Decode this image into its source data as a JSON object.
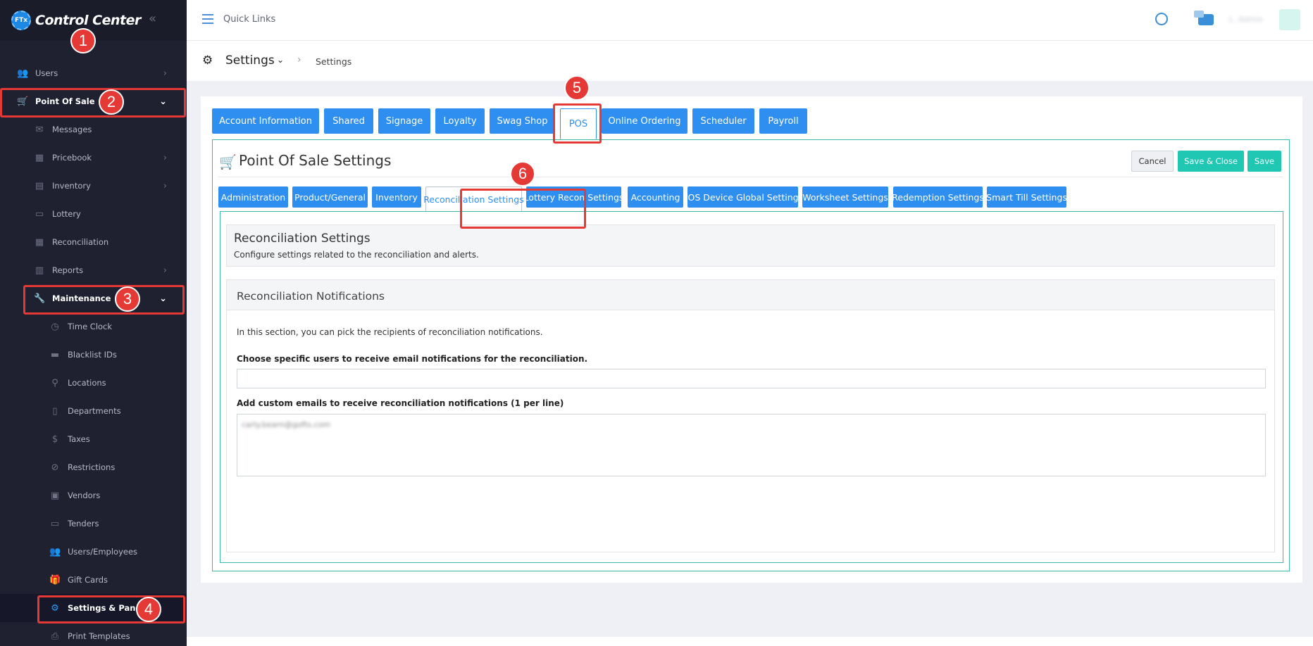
{
  "app": {
    "title": "Control Center",
    "logo_text": "FTx",
    "collapse_icon": "double-chevron-left-icon"
  },
  "topbar": {
    "quick_links": "Quick Links",
    "user_name": "L. Admin"
  },
  "breadcrumb": {
    "title": "Settings",
    "current": "Settings"
  },
  "sidebar": {
    "items": [
      {
        "label": "Users",
        "icon": "users-icon",
        "glyph": "👥",
        "chevron": "›"
      },
      {
        "label": "Point Of Sale",
        "icon": "cart-icon",
        "glyph": "🛒",
        "chevron": "⌄"
      },
      {
        "label": "Messages",
        "icon": "message-icon",
        "glyph": "✉"
      },
      {
        "label": "Pricebook",
        "icon": "calculator-icon",
        "glyph": "▦",
        "chevron": "›"
      },
      {
        "label": "Inventory",
        "icon": "inventory-icon",
        "glyph": "▤",
        "chevron": "›"
      },
      {
        "label": "Lottery",
        "icon": "ticket-icon",
        "glyph": "▭"
      },
      {
        "label": "Reconciliation",
        "icon": "grid-icon",
        "glyph": "▦"
      },
      {
        "label": "Reports",
        "icon": "chart-icon",
        "glyph": "▥",
        "chevron": "›"
      },
      {
        "label": "Maintenance",
        "icon": "wrench-icon",
        "glyph": "🔧",
        "chevron": "⌄"
      },
      {
        "label": "Time Clock",
        "icon": "clock-icon",
        "glyph": "◷"
      },
      {
        "label": "Blacklist IDs",
        "icon": "id-card-icon",
        "glyph": "▬"
      },
      {
        "label": "Locations",
        "icon": "map-pin-icon",
        "glyph": "⚲"
      },
      {
        "label": "Departments",
        "icon": "building-icon",
        "glyph": "▯"
      },
      {
        "label": "Taxes",
        "icon": "dollar-icon",
        "glyph": "$"
      },
      {
        "label": "Restrictions",
        "icon": "ban-icon",
        "glyph": "⊘"
      },
      {
        "label": "Vendors",
        "icon": "vendor-icon",
        "glyph": "▣"
      },
      {
        "label": "Tenders",
        "icon": "money-icon",
        "glyph": "▭"
      },
      {
        "label": "Users/Employees",
        "icon": "users-icon",
        "glyph": "👥"
      },
      {
        "label": "Gift Cards",
        "icon": "gift-icon",
        "glyph": "🎁"
      },
      {
        "label": "Settings & Panels",
        "icon": "gear-icon",
        "glyph": "⚙"
      },
      {
        "label": "Print Templates",
        "icon": "printer-icon",
        "glyph": "⎙"
      }
    ]
  },
  "main_tabs": [
    "Account Information",
    "Shared",
    "Signage",
    "Loyalty",
    "Swag Shop",
    "POS",
    "Online Ordering",
    "Scheduler",
    "Payroll"
  ],
  "section": {
    "title": "Point Of Sale Settings",
    "cancel": "Cancel",
    "save_close": "Save & Close",
    "save": "Save"
  },
  "sub_tabs": [
    "Administration",
    "Product/General",
    "Inventory",
    "Reconciliation Settings",
    "Lottery Recon Settings",
    "Accounting",
    "POS Device Global Settings",
    "Worksheet Settings",
    "Redemption Settings",
    "Smart Till Settings"
  ],
  "reconciliation": {
    "title": "Reconciliation Settings",
    "subtitle": "Configure settings related to the reconciliation and alerts.",
    "notifications_title": "Reconciliation Notifications",
    "description": "In this section, you can pick the recipients of reconciliation notifications.",
    "users_label": "Choose specific users to receive email notifications for the reconciliation.",
    "users_value": "",
    "emails_label": "Add custom emails to receive reconciliation notifications (1 per line)",
    "emails_value": "carly.bearn@gofts.com"
  },
  "annotations": [
    "1",
    "2",
    "3",
    "4",
    "5",
    "6"
  ],
  "colors": {
    "sidebar_bg": "#1f2130",
    "primary": "#2f8ff0",
    "teal": "#20c7b3",
    "annotation": "#e53935"
  }
}
